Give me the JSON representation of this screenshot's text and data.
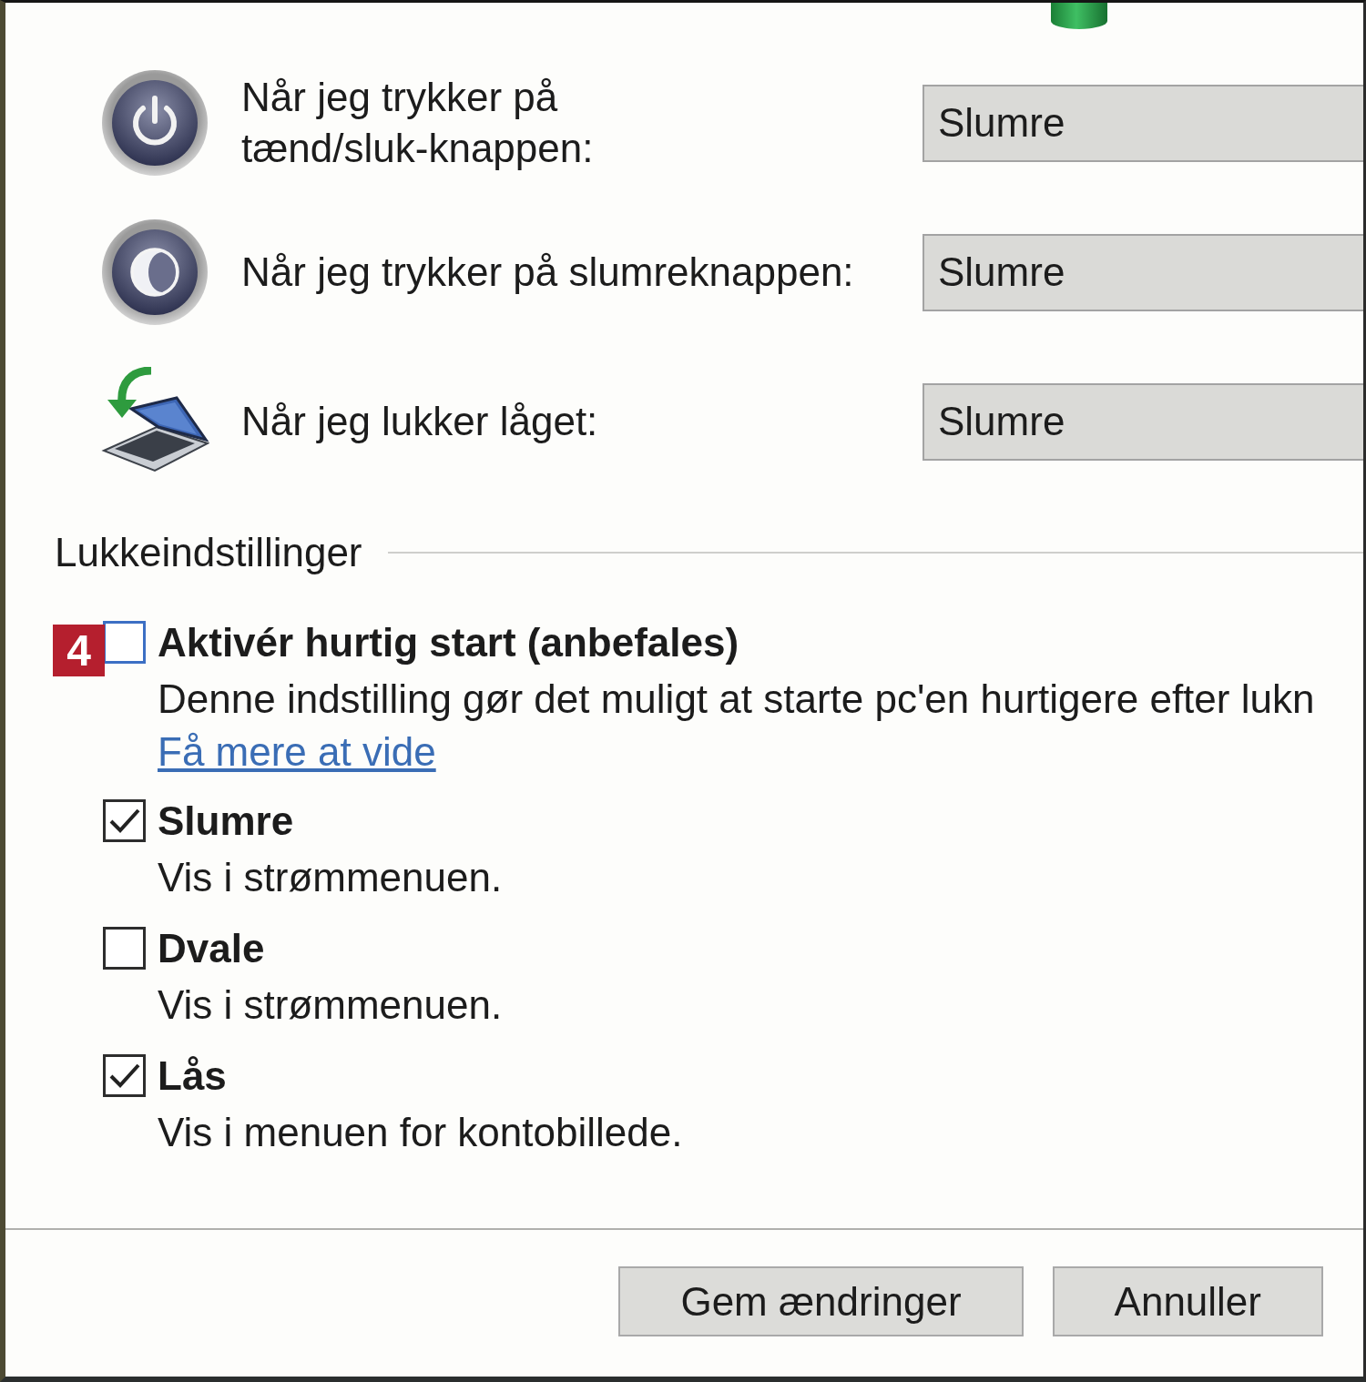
{
  "actions": [
    {
      "kind": "power",
      "label": "Når jeg trykker på tænd/sluk-knappen:",
      "value": "Slumre"
    },
    {
      "kind": "sleep",
      "label": "Når jeg trykker på slumreknappen:",
      "value": "Slumre"
    },
    {
      "kind": "lid",
      "label": "Når jeg lukker låget:",
      "value": "Slumre"
    }
  ],
  "shutdown_settings": {
    "title": "Lukkeindstillinger",
    "options": [
      {
        "badge": "4",
        "label": "Aktivér hurtig start (anbefales)",
        "description": "Denne indstilling gør det muligt at starte pc'en hurtigere efter lukn",
        "link": "Få mere at vide",
        "checked": false,
        "hovered": true
      },
      {
        "label": "Slumre",
        "description": "Vis i strømmenuen.",
        "checked": true,
        "hovered": false
      },
      {
        "label": "Dvale",
        "description": "Vis i strømmenuen.",
        "checked": false,
        "hovered": false
      },
      {
        "label": "Lås",
        "description": "Vis i menuen for kontobillede.",
        "checked": true,
        "hovered": false
      }
    ]
  },
  "buttons": [
    {
      "label": "Gem ændringer"
    },
    {
      "label": "Annuller"
    }
  ]
}
